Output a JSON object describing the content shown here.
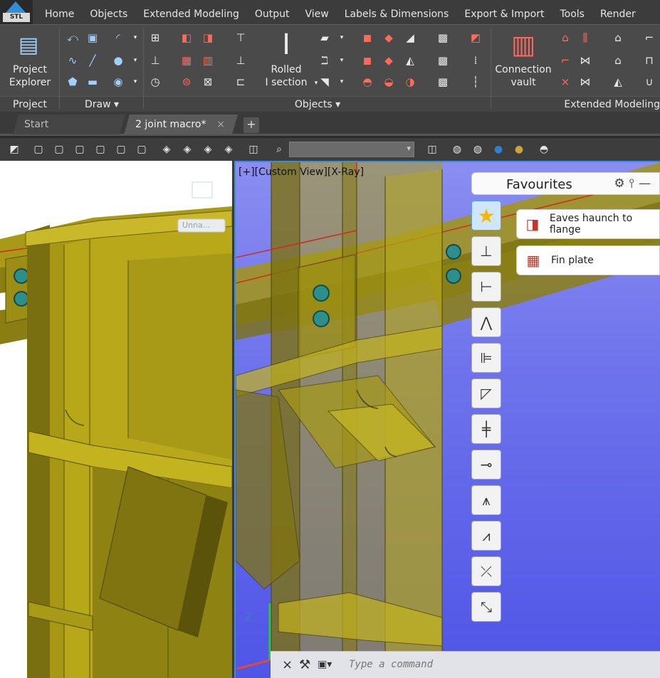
{
  "app": {
    "logo_text": "STL"
  },
  "menu_tabs": [
    "Home",
    "Objects",
    "Extended Modeling",
    "Output",
    "View",
    "Labels & Dimensions",
    "Export & Import",
    "Tools",
    "Render"
  ],
  "ribbon": {
    "groups": {
      "project": "Project",
      "draw": "Draw ▾",
      "objects": "Objects ▾",
      "extended": "Extended Modeling"
    },
    "project_explorer": [
      "Project",
      "Explorer"
    ],
    "rolled_section": [
      "Rolled",
      "I section"
    ],
    "connection_vault": [
      "Connection",
      "vault"
    ]
  },
  "doc_tabs": {
    "start": "Start",
    "current": "2 joint macro*",
    "close": "×",
    "add": "+"
  },
  "viewport_right": {
    "label": "[+][Custom View][X-Ray]"
  },
  "viewport_left": {
    "tag_text": "Unna..."
  },
  "favourites": {
    "title": "Favourites",
    "tools": [
      "gear-icon",
      "pin-icon",
      "minimize-icon"
    ],
    "items": [
      "Eaves haunch to flange",
      "Fin plate"
    ]
  },
  "command_line": {
    "placeholder": "Type a command",
    "close": "×"
  },
  "colors": {
    "steel": "#b5a418",
    "steel_dark": "#6e6410",
    "viewport_blue": "#5a60e8",
    "accent": "#3b8de0"
  }
}
